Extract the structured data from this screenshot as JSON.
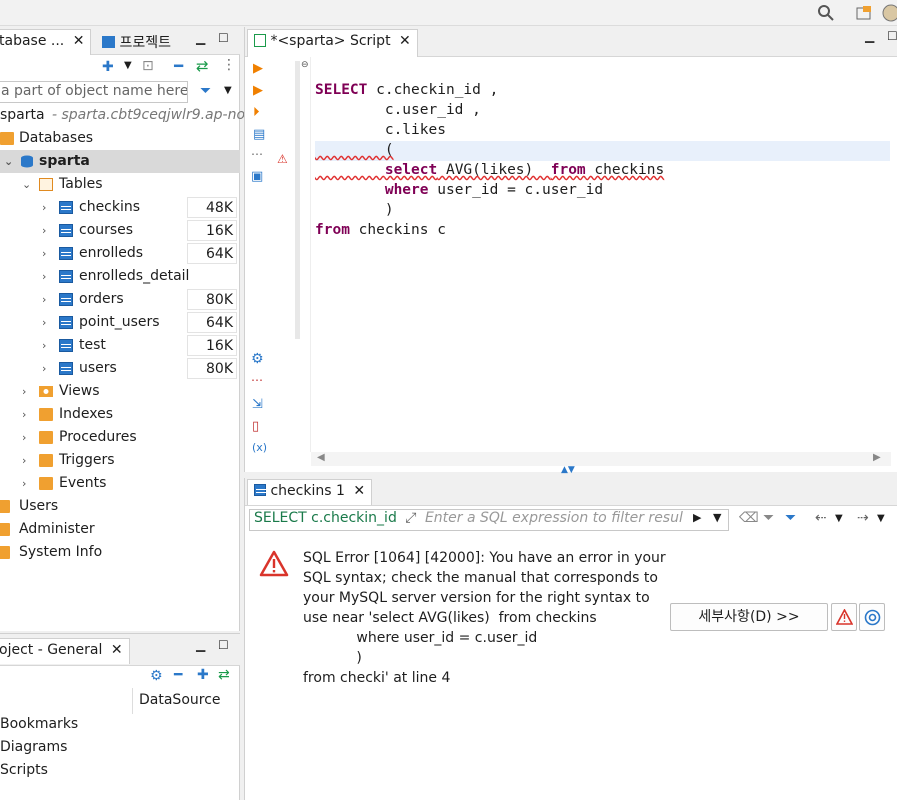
{
  "navigator": {
    "tabs": [
      {
        "label": "tabase ..."
      },
      {
        "label": "프로젝트"
      }
    ],
    "filter_placeholder": "a part of object name here",
    "connection": {
      "name": "sparta",
      "host": " - sparta.cbt9ceqjwlr9.ap-nor"
    },
    "tree": {
      "databases": "Databases",
      "schema": "sparta",
      "tables": "Tables",
      "table_items": [
        {
          "name": "checkins",
          "count": "48K"
        },
        {
          "name": "courses",
          "count": "16K"
        },
        {
          "name": "enrolleds",
          "count": "64K"
        },
        {
          "name": "enrolleds_detail",
          "count": ""
        },
        {
          "name": "orders",
          "count": "80K"
        },
        {
          "name": "point_users",
          "count": "64K"
        },
        {
          "name": "test",
          "count": "16K"
        },
        {
          "name": "users",
          "count": "80K"
        }
      ],
      "folders": [
        "Views",
        "Indexes",
        "Procedures",
        "Triggers",
        "Events"
      ],
      "top_level": [
        "Users",
        "Administer",
        "System Info"
      ]
    }
  },
  "properties": {
    "tab_label": "oject - General",
    "column_header": "DataSource",
    "rows": [
      "Bookmarks",
      "Diagrams",
      "Scripts"
    ]
  },
  "editor": {
    "tab_label": "*<sparta> Script",
    "code_lines": [
      {
        "kw": "SELECT",
        "rest": " c.checkin_id ,",
        "indent": ""
      },
      {
        "kw": "",
        "rest": "c.user_id ,",
        "indent": "        "
      },
      {
        "kw": "",
        "rest": "c.likes",
        "indent": "        "
      },
      {
        "kw": "",
        "rest": "(",
        "indent": "        "
      },
      {
        "kw": "select",
        "rest": " AVG(likes)  ",
        "kw2": "from",
        "rest2": " checkins",
        "indent": "        "
      },
      {
        "kw": "where",
        "rest": " user_id = c.user_id",
        "indent": "        "
      },
      {
        "kw": "",
        "rest": ")",
        "indent": "        "
      },
      {
        "kw": "from",
        "rest": " checkins c",
        "indent": ""
      }
    ]
  },
  "results": {
    "tab_label": "checkins 1",
    "filter_query": "SELECT c.checkin_id",
    "filter_placeholder": "Enter a SQL expression to filter resul",
    "error_lines": [
      "SQL Error [1064] [42000]: You have an error in your",
      "SQL syntax; check the manual that corresponds to",
      "your MySQL server version for the right syntax to",
      "use near 'select AVG(likes)  from checkins",
      "            where user_id = c.user_id",
      "            )",
      "from checki' at line 4"
    ],
    "details_button": "세부사항(D) >>"
  },
  "colors": {
    "accent": "#2b78c9",
    "keyword": "#7f0055",
    "error": "#d9342b",
    "selection": "#d9d9d9"
  }
}
